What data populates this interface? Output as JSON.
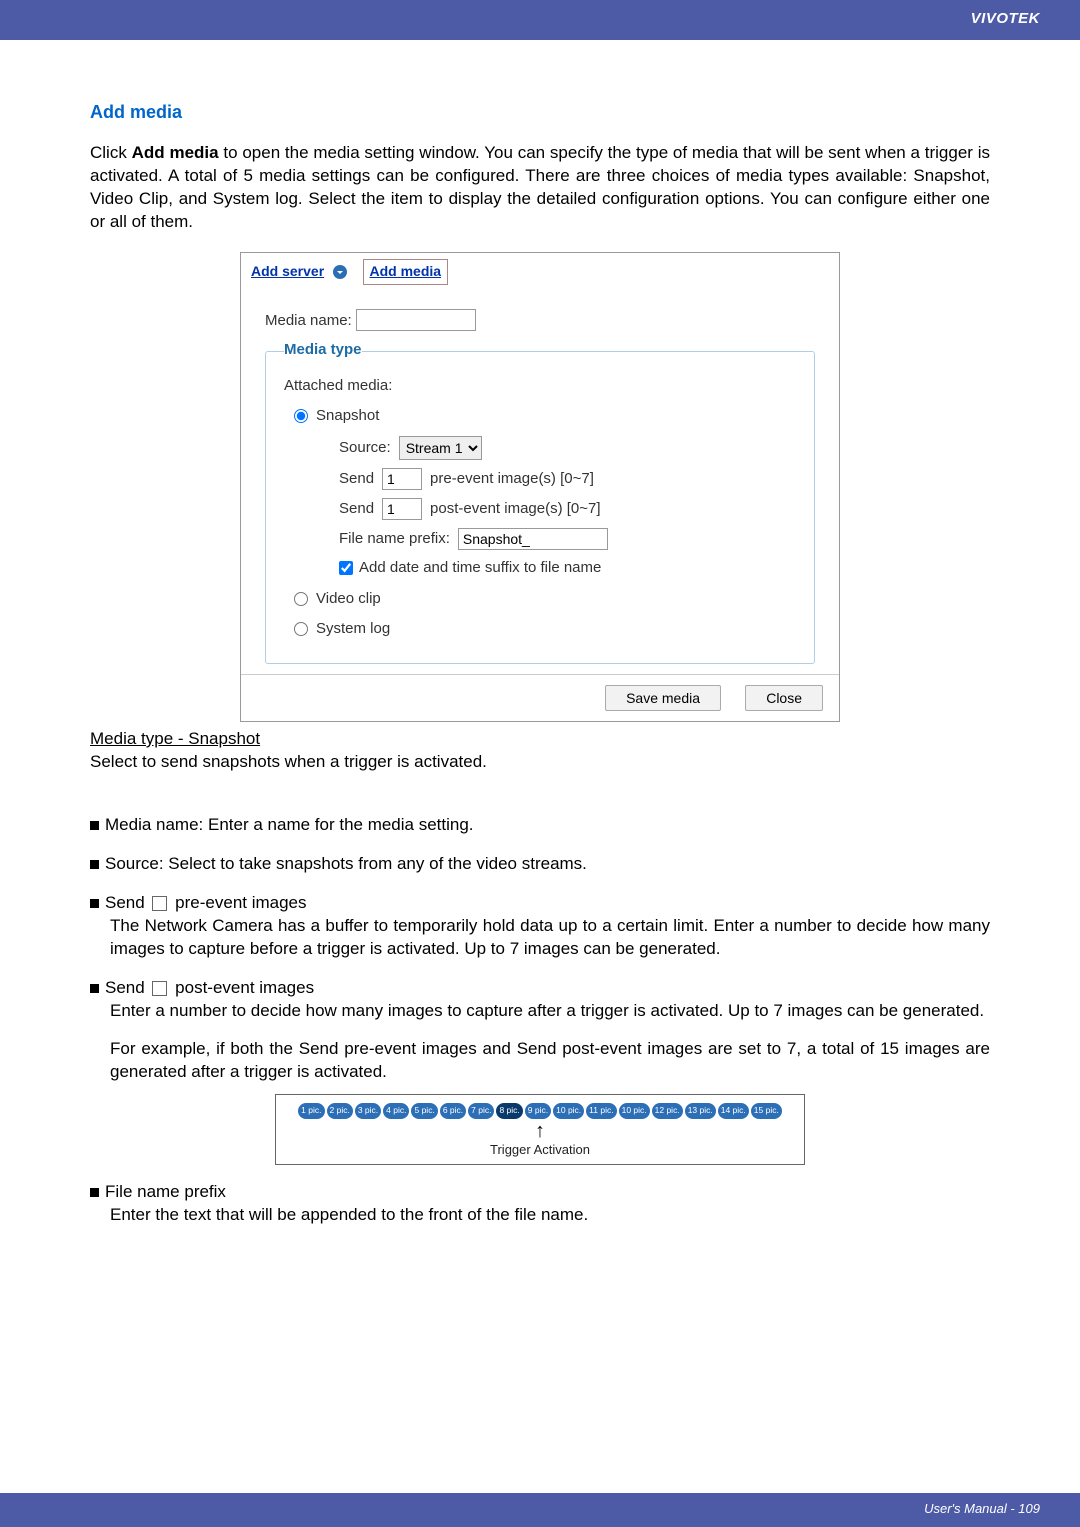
{
  "header": {
    "brand": "VIVOTEK"
  },
  "section": {
    "title": "Add media",
    "intro_prefix": "Click ",
    "intro_strong": "Add media",
    "intro_rest": " to open the media setting window. You can specify the type of media that will be sent when a trigger is activated. A total of 5 media settings can be configured. There are three choices of media types available: Snapshot, Video Clip, and System log. Select the item to display the detailed configuration options. You can configure either one or all of them."
  },
  "panel": {
    "links": {
      "add_server": "Add server",
      "add_media": "Add media"
    },
    "media_name_label": "Media name:",
    "media_name_value": "",
    "fieldset": {
      "legend": "Media type",
      "attached": "Attached media:",
      "radios": {
        "snapshot": "Snapshot",
        "video_clip": "Video clip",
        "system_log": "System log"
      },
      "source_label": "Source:",
      "source_value": "Stream 1",
      "send_label": "Send",
      "pre_value": "1",
      "pre_suffix": "pre-event image(s) [0~7]",
      "post_value": "1",
      "post_suffix": "post-event image(s) [0~7]",
      "prefix_label": "File name prefix:",
      "prefix_value": "Snapshot_",
      "checkbox_label": "Add date and time suffix to file name"
    },
    "buttons": {
      "save": "Save media",
      "close": "Close"
    }
  },
  "snapshot_section": {
    "heading": "Media type - Snapshot",
    "sub": "Select to send snapshots when a trigger is activated.",
    "bullets": {
      "media_name": "Media name: Enter a name for the media setting.",
      "source": "Source: Select to take snapshots from any of the video streams.",
      "send_pre_label": "Send",
      "send_pre_rest": "pre-event images",
      "send_pre_desc": "The Network Camera has a buffer to temporarily hold data up to a certain limit. Enter a number to decide how many images to capture before a trigger is activated. Up to 7 images can be generated.",
      "send_post_label": "Send",
      "send_post_rest": "post-event images",
      "send_post_desc1": "Enter a number to decide how many images to capture after a trigger is activated. Up to 7 images can be generated.",
      "send_post_desc2": "For example, if both the Send pre-event images and Send post-event images are set to 7, a total of 15 images are generated after a trigger is activated.",
      "file_prefix_label": "File name prefix",
      "file_prefix_desc": "Enter the text that will be appended to the front of the file name."
    }
  },
  "diagram": {
    "pills": [
      "1 pic.",
      "2 pic.",
      "3 pic.",
      "4 pic.",
      "5 pic.",
      "6 pic.",
      "7 pic.",
      "8 pic.",
      "9 pic.",
      "10 pic.",
      "11 pic.",
      "10 pic.",
      "12 pic.",
      "13 pic.",
      "14 pic.",
      "15 pic."
    ],
    "trigger_index": 7,
    "caption": "Trigger Activation"
  },
  "footer": {
    "text": "User's Manual - 109"
  }
}
